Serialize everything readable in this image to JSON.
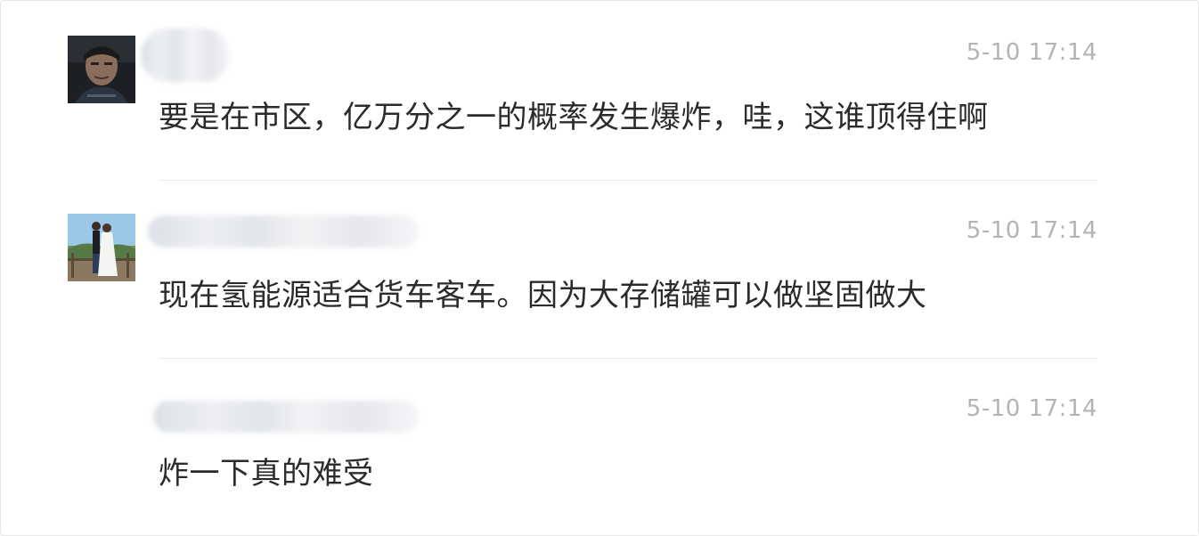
{
  "comments": [
    {
      "avatar_icon": "user-avatar-animated-character-icon",
      "timestamp": "5-10 17:14",
      "text": "要是在市区，亿万分之一的概率发生爆炸，哇，这谁顶得住啊"
    },
    {
      "avatar_icon": "user-avatar-couple-photo-icon",
      "timestamp": "5-10 17:14",
      "text": "现在氢能源适合货车客车。因为大存储罐可以做坚固做大"
    },
    {
      "timestamp": "5-10 17:14",
      "text": "炸一下真的难受"
    }
  ],
  "colors": {
    "text": "#2b2b2b",
    "timestamp": "#b4b4b4",
    "divider": "#ececec"
  }
}
